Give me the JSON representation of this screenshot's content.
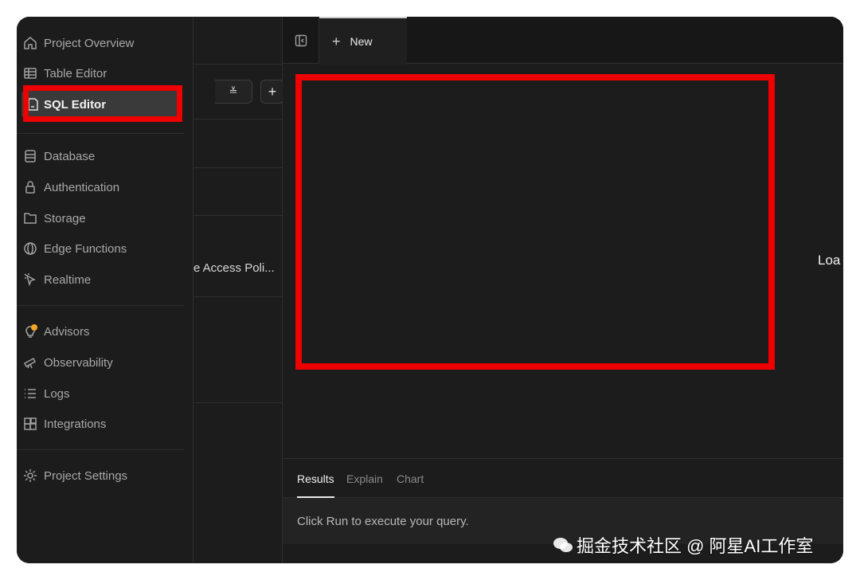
{
  "sidebar": {
    "items": [
      {
        "label": "Project Overview",
        "icon": "home-icon"
      },
      {
        "label": "Table Editor",
        "icon": "table-icon"
      },
      {
        "label": "SQL Editor",
        "icon": "sql-file-icon",
        "active": true
      },
      {
        "label": "Database",
        "icon": "database-icon"
      },
      {
        "label": "Authentication",
        "icon": "lock-icon"
      },
      {
        "label": "Storage",
        "icon": "folder-icon"
      },
      {
        "label": "Edge Functions",
        "icon": "globe-icon"
      },
      {
        "label": "Realtime",
        "icon": "cursor-icon"
      },
      {
        "label": "Advisors",
        "icon": "lightbulb-icon"
      },
      {
        "label": "Observability",
        "icon": "telescope-icon"
      },
      {
        "label": "Logs",
        "icon": "list-icon"
      },
      {
        "label": "Integrations",
        "icon": "integrations-icon"
      },
      {
        "label": "Project Settings",
        "icon": "gear-icon"
      }
    ]
  },
  "mid": {
    "add_label": "+",
    "policy_item": "e Access Poli..."
  },
  "editor": {
    "tab_new_label": "New",
    "loading_text": "Loa"
  },
  "results": {
    "tabs": [
      "Results",
      "Explain",
      "Chart"
    ],
    "message": "Click Run to execute your query."
  },
  "watermark": {
    "text": "掘金技术社区 @ 阿星AI工作室"
  },
  "colors": {
    "background": "#1c1c1c",
    "highlight": "#ee0000",
    "advisor_dot": "#f5a623"
  }
}
